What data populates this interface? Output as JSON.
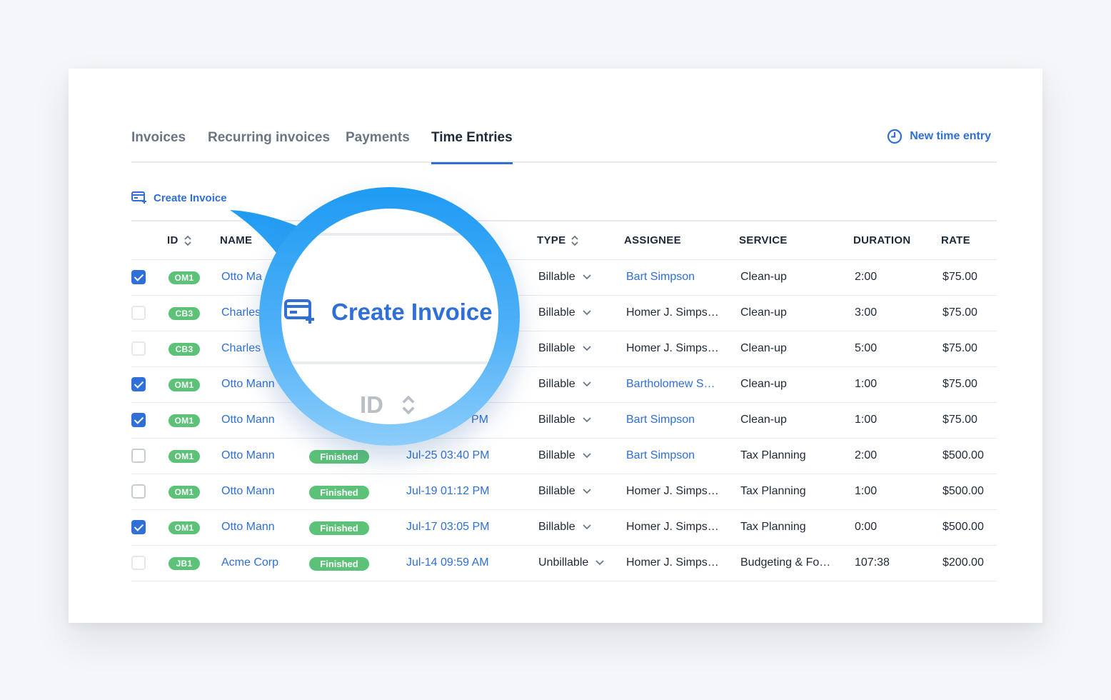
{
  "tabs": [
    {
      "label": "Invoices",
      "active": false
    },
    {
      "label": "Recurring invoices",
      "active": false
    },
    {
      "label": "Payments",
      "active": false
    },
    {
      "label": "Time Entries",
      "active": true
    }
  ],
  "header": {
    "new_entry_label": "New time entry"
  },
  "actions": {
    "create_invoice_label": "Create Invoice"
  },
  "table": {
    "columns": [
      "ID",
      "NAME",
      "TYPE",
      "ASSIGNEE",
      "SERVICE",
      "DURATION",
      "RATE"
    ],
    "rows": [
      {
        "checked": true,
        "id": "OM1",
        "name": "Otto Ma",
        "status": "",
        "date": "",
        "type": "Billable",
        "assignee": "Bart Simpson",
        "assignee_link": true,
        "service": "Clean-up",
        "duration": "2:00",
        "rate": "$75.00",
        "dim": false
      },
      {
        "checked": false,
        "id": "CB3",
        "name": "Charles",
        "status": "",
        "date": "",
        "type": "Billable",
        "assignee": "Homer J. Simps…",
        "assignee_link": false,
        "service": "Clean-up",
        "duration": "3:00",
        "rate": "$75.00",
        "dim": true
      },
      {
        "checked": false,
        "id": "CB3",
        "name": "Charles",
        "status": "",
        "date": "",
        "type": "Billable",
        "assignee": "Homer J. Simps…",
        "assignee_link": false,
        "service": "Clean-up",
        "duration": "5:00",
        "rate": "$75.00",
        "dim": true
      },
      {
        "checked": true,
        "id": "OM1",
        "name": "Otto Mann",
        "status": "",
        "date": "",
        "type": "Billable",
        "assignee": "Bartholomew S…",
        "assignee_link": true,
        "service": "Clean-up",
        "duration": "1:00",
        "rate": "$75.00",
        "dim": false
      },
      {
        "checked": true,
        "id": "OM1",
        "name": "Otto Mann",
        "status": "",
        "date": "PM",
        "type": "Billable",
        "assignee": "Bart Simpson",
        "assignee_link": true,
        "service": "Clean-up",
        "duration": "1:00",
        "rate": "$75.00",
        "dim": false
      },
      {
        "checked": false,
        "id": "OM1",
        "name": "Otto Mann",
        "status": "Finished",
        "date": "Jul-25 03:40 PM",
        "type": "Billable",
        "assignee": "Bart Simpson",
        "assignee_link": true,
        "service": "Tax Planning",
        "duration": "2:00",
        "rate": "$500.00",
        "dim": false
      },
      {
        "checked": false,
        "id": "OM1",
        "name": "Otto Mann",
        "status": "Finished",
        "date": "Jul-19 01:12 PM",
        "type": "Billable",
        "assignee": "Homer J. Simps…",
        "assignee_link": false,
        "service": "Tax Planning",
        "duration": "1:00",
        "rate": "$500.00",
        "dim": false
      },
      {
        "checked": true,
        "id": "OM1",
        "name": "Otto Mann",
        "status": "Finished",
        "date": "Jul-17 03:05 PM",
        "type": "Billable",
        "assignee": "Homer J. Simps…",
        "assignee_link": false,
        "service": "Tax Planning",
        "duration": "0:00",
        "rate": "$500.00",
        "dim": false
      },
      {
        "checked": false,
        "id": "JB1",
        "name": "Acme Corp",
        "status": "Finished",
        "date": "Jul-14 09:59 AM",
        "type": "Unbillable",
        "assignee": "Homer J. Simps…",
        "assignee_link": false,
        "service": "Budgeting & Fo…",
        "duration": "107:38",
        "rate": "$200.00",
        "dim": true
      }
    ]
  },
  "magnifier": {
    "title": "Create Invoice",
    "column": "ID"
  },
  "colors": {
    "accent": "#2f6fd6",
    "badge": "#5cc277",
    "lens": "#1e9bf3"
  }
}
